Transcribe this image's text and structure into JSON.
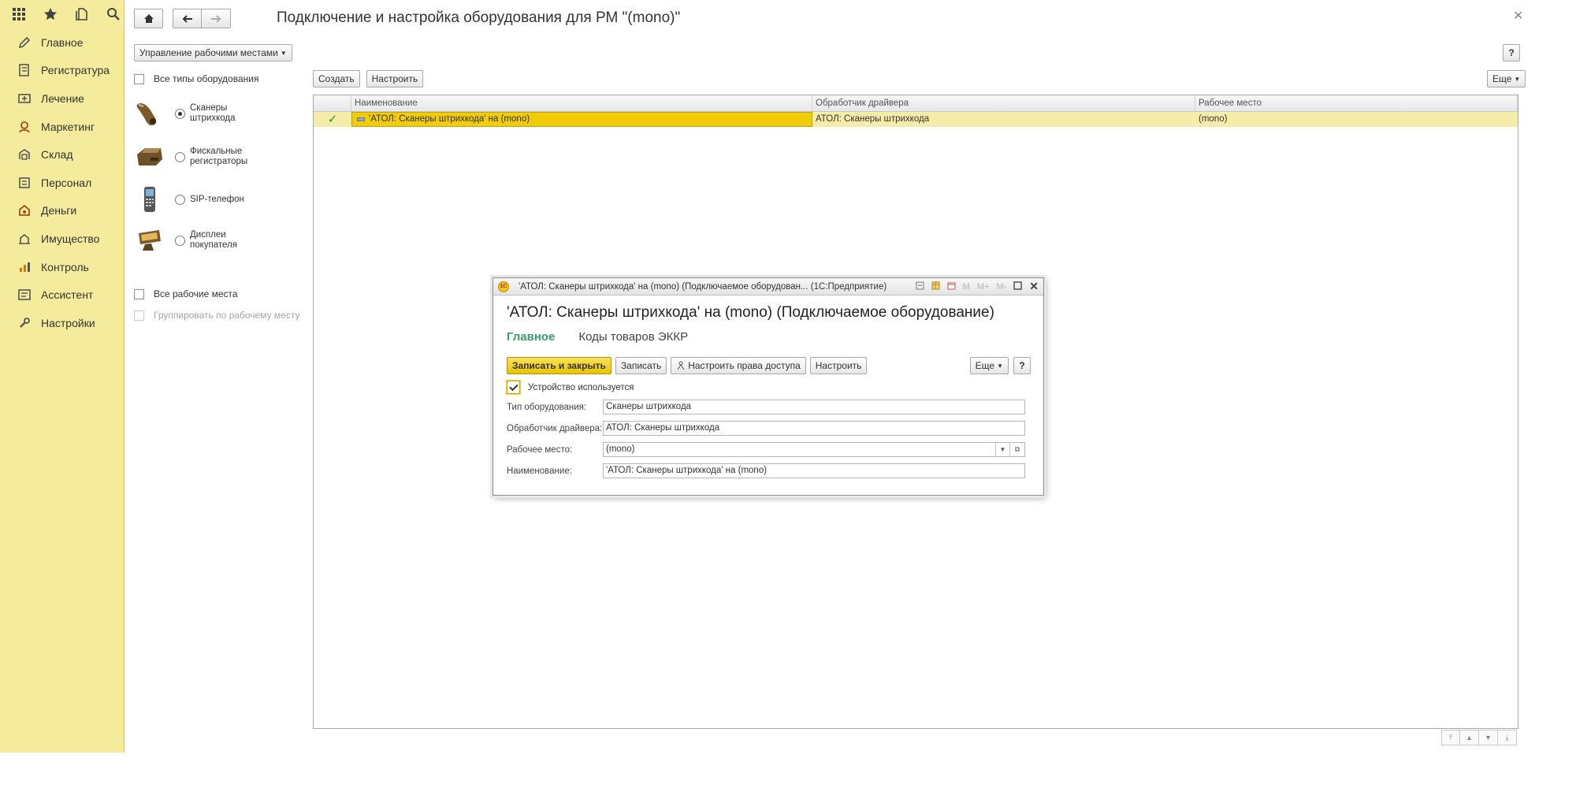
{
  "page": {
    "title": "Подключение и настройка оборудования для РМ \"(mono)\""
  },
  "sidebar": {
    "items": [
      {
        "label": "Главное",
        "icon": "pencil-icon"
      },
      {
        "label": "Регистратура",
        "icon": "register-icon"
      },
      {
        "label": "Лечение",
        "icon": "treatment-icon"
      },
      {
        "label": "Маркетинг",
        "icon": "marketing-icon"
      },
      {
        "label": "Склад",
        "icon": "warehouse-icon"
      },
      {
        "label": "Персонал",
        "icon": "staff-icon"
      },
      {
        "label": "Деньги",
        "icon": "money-icon"
      },
      {
        "label": "Имущество",
        "icon": "property-icon"
      },
      {
        "label": "Контроль",
        "icon": "chart-icon"
      },
      {
        "label": "Ассистент",
        "icon": "assistant-icon"
      },
      {
        "label": "Настройки",
        "icon": "wrench-icon"
      }
    ]
  },
  "filters": {
    "workplaces_dropdown": "Управление рабочими местами",
    "all_types_label": "Все типы оборудования",
    "equipment_types": [
      {
        "label": "Сканеры штрихкода",
        "selected": true,
        "icon": "barcode-scanner-icon"
      },
      {
        "label": "Фискальные регистраторы",
        "selected": false,
        "icon": "fiscal-printer-icon"
      },
      {
        "label": "SIP-телефон",
        "selected": false,
        "icon": "sip-phone-icon"
      },
      {
        "label": "Дисплеи покупателя",
        "selected": false,
        "icon": "customer-display-icon"
      }
    ],
    "all_workplaces_label": "Все рабочие места",
    "group_by_workplace_label": "Группировать по рабочему месту"
  },
  "toolbar": {
    "create_label": "Создать",
    "configure_label": "Настроить",
    "more_label": "Еще"
  },
  "table": {
    "columns": [
      "Наименование",
      "Обработчик драйвера",
      "Рабочее место"
    ],
    "rows": [
      {
        "used": true,
        "name": "'АТОЛ: Сканеры штрихкода' на (mono)",
        "driver": "АТОЛ: Сканеры штрихкода",
        "workplace": "(mono)"
      }
    ]
  },
  "dialog": {
    "window_title": "'АТОЛ: Сканеры штрихкода' на (mono) (Подключаемое оборудован...  (1С:Предприятие)",
    "title_icons": {
      "m": "M",
      "m_plus": "M+",
      "m_minus": "M-"
    },
    "heading": "'АТОЛ: Сканеры штрихкода' на (mono) (Подключаемое оборудование)",
    "tabs": [
      "Главное",
      "Коды товаров ЭККР"
    ],
    "buttons": {
      "save_close": "Записать и закрыть",
      "save": "Записать",
      "access_rights": "Настроить права доступа",
      "configure": "Настроить",
      "more": "Еще",
      "help": "?"
    },
    "device_used_label": "Устройство используется",
    "device_used": true,
    "fields": {
      "equipment_type": {
        "label": "Тип оборудования:",
        "value": "Сканеры штрихкода"
      },
      "driver": {
        "label": "Обработчик драйвера:",
        "value": "АТОЛ: Сканеры штрихкода"
      },
      "workplace": {
        "label": "Рабочее место:",
        "value": "(mono)"
      },
      "name": {
        "label": "Наименование:",
        "value": "'АТОЛ: Сканеры штрихкода' на (mono)"
      }
    }
  },
  "help_label": "?",
  "colors": {
    "sidebar_bg": "#f5eb9c",
    "selected_row": "#f6ecaa",
    "selected_cell": "#f0cc0a",
    "active_tab": "#3a9b6b",
    "primary_button": "#e8c300"
  }
}
